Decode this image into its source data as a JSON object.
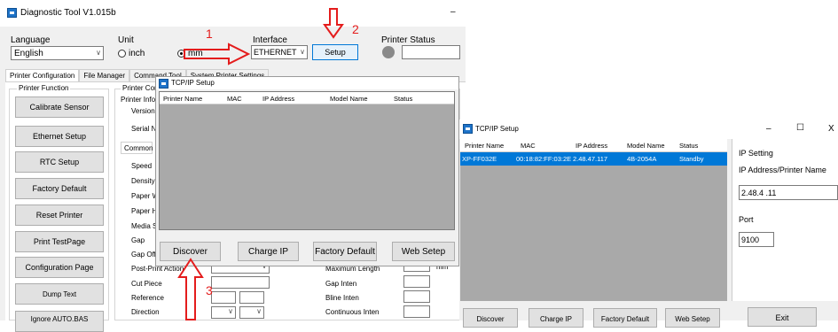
{
  "main_window": {
    "title": "Diagnostic Tool V1.015b",
    "minimize": "–",
    "language": {
      "label": "Language",
      "value": "English"
    },
    "unit": {
      "label": "Unit",
      "inch": "inch",
      "mm": "mm"
    },
    "interface": {
      "label": "Interface",
      "value": "ETHERNET",
      "setup": "Setup"
    },
    "printer_status": {
      "label": "Printer Status"
    },
    "tabs": [
      "Printer Configuration",
      "File Manager",
      "Command Tool",
      "System Printer Settings"
    ],
    "printer_function": {
      "label": "Printer Function",
      "buttons": [
        "Calibrate Sensor",
        "Ethernet Setup",
        "RTC Setup",
        "Factory Default",
        "Reset Printer",
        "Print TestPage",
        "Configuration Page",
        "Dump Text",
        "Ignore AUTO.BAS"
      ]
    },
    "printer_config": {
      "label": "Printer Confi",
      "info_label": "Printer Info",
      "version": "Version",
      "serial": "Serial NO",
      "common_tab": "Common",
      "settings": [
        "Speed",
        "Density",
        "Paper W",
        "Paper H",
        "Media S",
        "Gap",
        "Gap Off",
        "Post-Print Action",
        "Cut Piece",
        "Reference",
        "Direction"
      ],
      "right_settings": [
        "Maximum Length",
        "Gap Inten",
        "Bline Inten",
        "Continuous Inten"
      ],
      "mm_unit": "mm"
    }
  },
  "tcp_small": {
    "title": "TCP/IP Setup",
    "columns": [
      "Printer Name",
      "MAC",
      "IP Address",
      "Model Name",
      "Status"
    ],
    "buttons": [
      "Discover",
      "Charge IP",
      "Factory Default",
      "Web Setep"
    ]
  },
  "tcp_large": {
    "title": "TCP/IP Setup",
    "window_controls": {
      "min": "–",
      "max": "☐",
      "close": "X"
    },
    "columns": [
      "Printer Name",
      "MAC",
      "IP Address",
      "Model Name",
      "Status"
    ],
    "rows": [
      [
        "XP-FF032E",
        "00:18:82:FF:03:2E",
        "2.48.47.117",
        "4B-2054A",
        "Standby"
      ]
    ],
    "ip_setting": "IP Setting",
    "ip_label": "IP Address/Printer Name",
    "ip_value": "2.48.4 .11",
    "port_label": "Port",
    "port_value": "9100",
    "buttons": [
      "Discover",
      "Charge IP",
      "Factory Default",
      "Web Setep"
    ],
    "exit": "Exit"
  },
  "annotations": [
    "1",
    "2",
    "3"
  ],
  "colors": {
    "accent": "#0078d7",
    "arrow": "#e41c1c",
    "grid": "#a9a9a9"
  }
}
